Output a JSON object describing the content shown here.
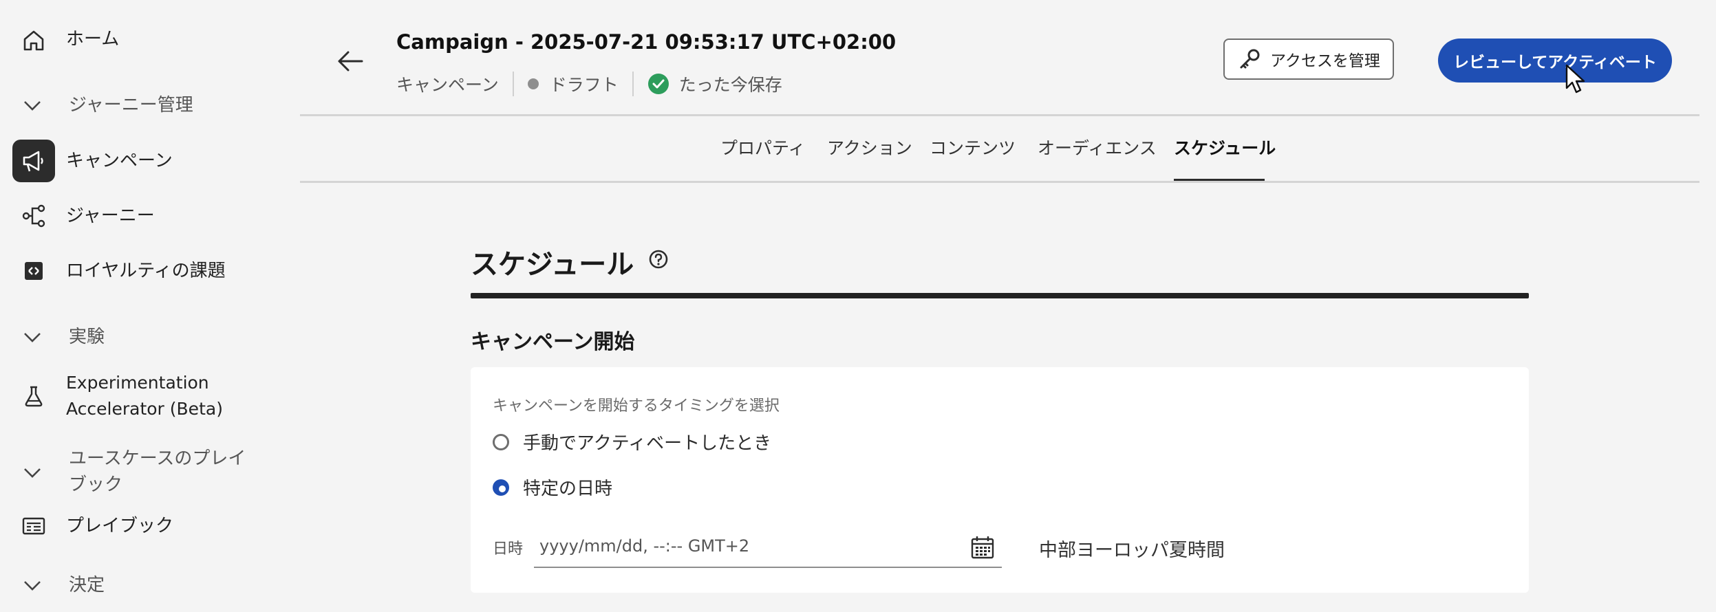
{
  "sidebar": {
    "home": "ホーム",
    "section_journey_mgmt": "ジャーニー管理",
    "campaigns": "キャンペーン",
    "journeys": "ジャーニー",
    "loyalty": "ロイヤルティの課題",
    "section_experiments": "実験",
    "experimentation_line1": "Experimentation",
    "experimentation_line2": "Accelerator (Beta)",
    "section_playbook_line1": "ユースケースのプレイ",
    "section_playbook_line2": "ブック",
    "playbooks": "プレイブック",
    "section_decisions": "決定"
  },
  "header": {
    "title": "Campaign - 2025-07-21 09:53:17 UTC+02:00",
    "type": "キャンペーン",
    "status": "ドラフト",
    "saved": "たった今保存",
    "manage_access": "アクセスを管理",
    "review_activate": "レビューしてアクティベート"
  },
  "tabs": [
    "プロパティ",
    "アクション",
    "コンテンツ",
    "オーディエンス",
    "スケジュール"
  ],
  "active_tab_index": 4,
  "schedule": {
    "heading": "スケジュール",
    "section_title": "キャンペーン開始",
    "field_label": "キャンペーンを開始するタイミングを選択",
    "option_manual": "手動でアクティベートしたとき",
    "option_specific": "特定の日時",
    "selected_option": "特定の日時",
    "datetime_label": "日時",
    "datetime_placeholder": "yyyy/mm/dd, --:-- GMT+2",
    "timezone": "中部ヨーロッパ夏時間"
  },
  "colors": {
    "accent": "#1f4fb4",
    "success": "#2d9d5c",
    "background": "#f4f4f4"
  },
  "icons": [
    "home-icon",
    "chevron-down-icon",
    "megaphone-icon",
    "journey-icon",
    "loyalty-icon",
    "flask-icon",
    "playbook-icon",
    "back-arrow-icon",
    "check-circle-icon",
    "key-icon",
    "help-icon",
    "calendar-icon",
    "cursor-icon"
  ]
}
